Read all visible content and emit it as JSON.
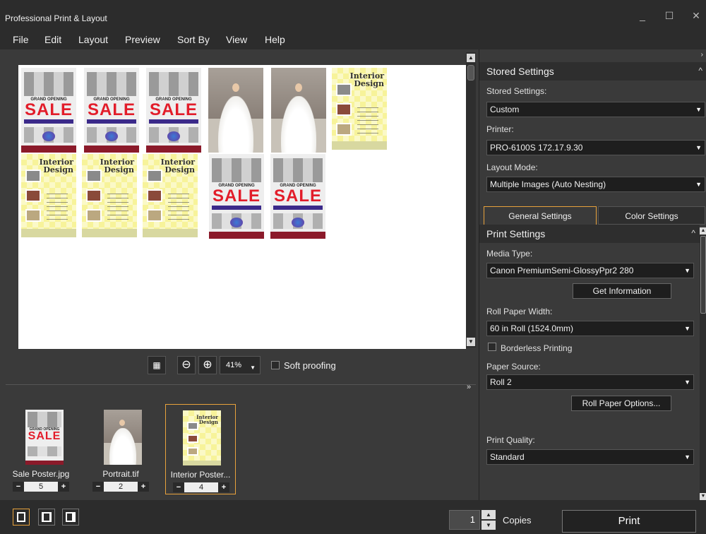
{
  "window": {
    "title": "Professional Print & Layout",
    "minimize": "_",
    "maximize": "☐",
    "close": "✕"
  },
  "menu": [
    "File",
    "Edit",
    "Layout",
    "Preview",
    "Sort By",
    "View",
    "Help"
  ],
  "canvas": {
    "poster_go": "GRAND OPENING",
    "poster_sale": "SALE",
    "poster_interior_1": "Interior",
    "poster_interior_2": "Design"
  },
  "zoom": {
    "value": "41%",
    "soft_proofing": "Soft proofing"
  },
  "tray": [
    {
      "name": "Sale Poster.jpg",
      "count": "5"
    },
    {
      "name": "Portrait.tif",
      "count": "2"
    },
    {
      "name": "Interior Poster...",
      "count": "4"
    }
  ],
  "bottom": {
    "copies_value": "1",
    "copies_label": "Copies",
    "print_label": "Print"
  },
  "panel": {
    "stored_header": "Stored Settings",
    "stored_label": "Stored Settings:",
    "stored_value": "Custom",
    "printer_label": "Printer:",
    "printer_value": "PRO-6100S 172.17.9.30",
    "layout_label": "Layout Mode:",
    "layout_value": "Multiple Images (Auto Nesting)",
    "tab_general": "General Settings",
    "tab_color": "Color Settings",
    "print_header": "Print Settings",
    "media_label": "Media Type:",
    "media_value": "Canon PremiumSemi-GlossyPpr2 280",
    "get_info": "Get Information",
    "roll_width_label": "Roll Paper Width:",
    "roll_width_value": "60 in Roll (1524.0mm)",
    "borderless": "Borderless Printing",
    "source_label": "Paper Source:",
    "source_value": "Roll 2",
    "roll_options": "Roll Paper Options...",
    "quality_label": "Print Quality:",
    "quality_value": "Standard"
  }
}
